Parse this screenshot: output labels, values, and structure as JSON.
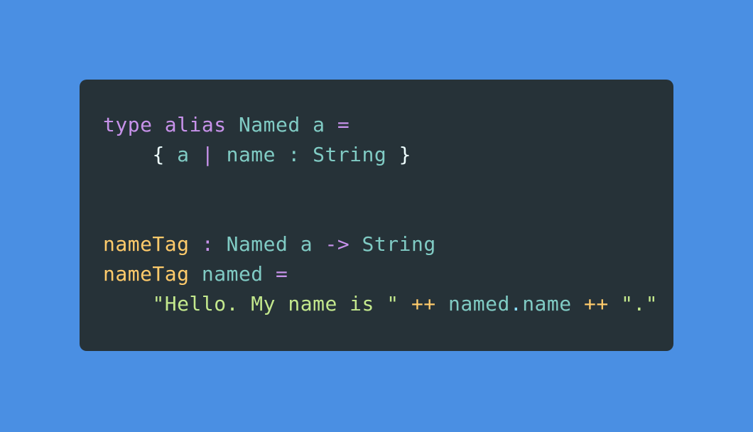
{
  "colors": {
    "background": "#4a8fe3",
    "card": "#263238",
    "keyword": "#c792ea",
    "type": "#80cbc4",
    "function": "#ffcb6b",
    "string": "#c3e88d",
    "punctuation": "#89ddff",
    "brace": "#eeffff",
    "operator": "#ffcb6b"
  },
  "code": {
    "lines": [
      [
        {
          "text": "type",
          "kind": "keyword"
        },
        {
          "text": " ",
          "kind": "plain"
        },
        {
          "text": "alias",
          "kind": "keyword"
        },
        {
          "text": " ",
          "kind": "plain"
        },
        {
          "text": "Named",
          "kind": "type"
        },
        {
          "text": " ",
          "kind": "plain"
        },
        {
          "text": "a",
          "kind": "type"
        },
        {
          "text": " ",
          "kind": "plain"
        },
        {
          "text": "=",
          "kind": "keyword"
        }
      ],
      [
        {
          "text": "    ",
          "kind": "plain"
        },
        {
          "text": "{",
          "kind": "brace"
        },
        {
          "text": " ",
          "kind": "plain"
        },
        {
          "text": "a",
          "kind": "type"
        },
        {
          "text": " ",
          "kind": "plain"
        },
        {
          "text": "|",
          "kind": "keyword"
        },
        {
          "text": " ",
          "kind": "plain"
        },
        {
          "text": "name",
          "kind": "type"
        },
        {
          "text": " ",
          "kind": "plain"
        },
        {
          "text": ":",
          "kind": "type"
        },
        {
          "text": " ",
          "kind": "plain"
        },
        {
          "text": "String",
          "kind": "type"
        },
        {
          "text": " ",
          "kind": "plain"
        },
        {
          "text": "}",
          "kind": "brace"
        }
      ],
      [],
      [],
      [
        {
          "text": "nameTag",
          "kind": "function"
        },
        {
          "text": " ",
          "kind": "plain"
        },
        {
          "text": ":",
          "kind": "keyword"
        },
        {
          "text": " ",
          "kind": "plain"
        },
        {
          "text": "Named",
          "kind": "type"
        },
        {
          "text": " ",
          "kind": "plain"
        },
        {
          "text": "a",
          "kind": "type"
        },
        {
          "text": " ",
          "kind": "plain"
        },
        {
          "text": "->",
          "kind": "keyword"
        },
        {
          "text": " ",
          "kind": "plain"
        },
        {
          "text": "String",
          "kind": "type"
        }
      ],
      [
        {
          "text": "nameTag",
          "kind": "function"
        },
        {
          "text": " ",
          "kind": "plain"
        },
        {
          "text": "named",
          "kind": "type"
        },
        {
          "text": " ",
          "kind": "plain"
        },
        {
          "text": "=",
          "kind": "keyword"
        }
      ],
      [
        {
          "text": "    ",
          "kind": "plain"
        },
        {
          "text": "\"Hello. My name is \"",
          "kind": "string"
        },
        {
          "text": " ",
          "kind": "plain"
        },
        {
          "text": "++",
          "kind": "operator"
        },
        {
          "text": " ",
          "kind": "plain"
        },
        {
          "text": "named",
          "kind": "type"
        },
        {
          "text": ".",
          "kind": "punctuation"
        },
        {
          "text": "name",
          "kind": "type"
        },
        {
          "text": " ",
          "kind": "plain"
        },
        {
          "text": "++",
          "kind": "operator"
        },
        {
          "text": " ",
          "kind": "plain"
        },
        {
          "text": "\".\"",
          "kind": "string"
        }
      ]
    ]
  }
}
